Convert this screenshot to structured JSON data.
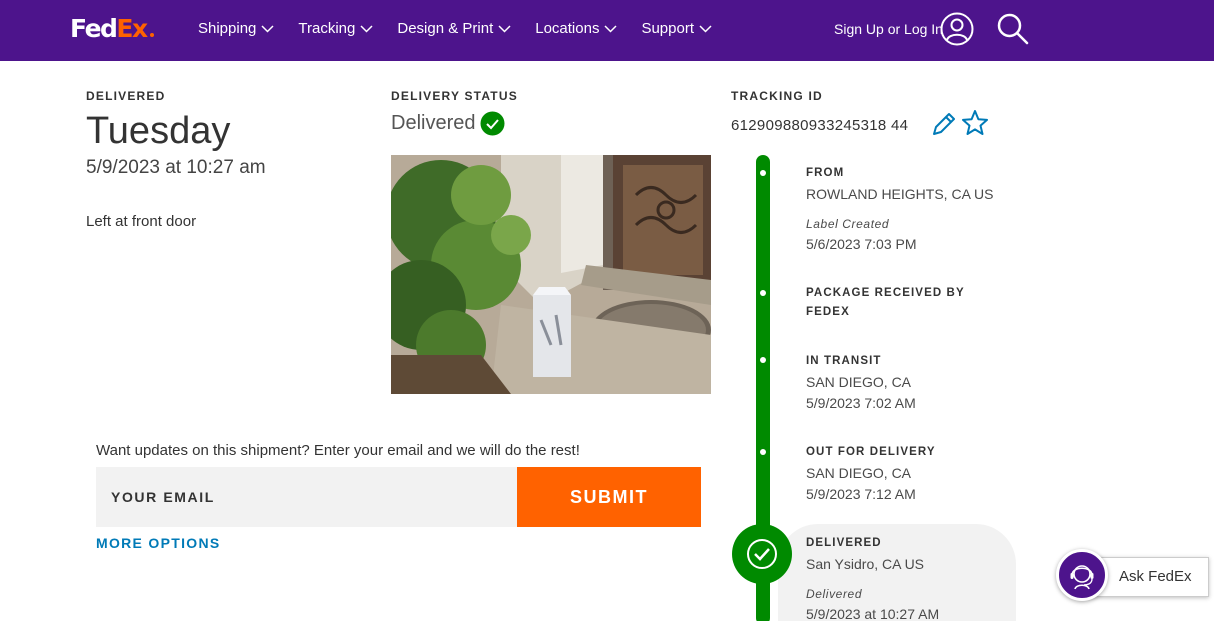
{
  "header": {
    "logo": {
      "fed": "Fed",
      "ex": "Ex"
    },
    "nav": [
      {
        "label": "Shipping"
      },
      {
        "label": "Tracking"
      },
      {
        "label": "Design & Print"
      },
      {
        "label": "Locations"
      },
      {
        "label": "Support"
      }
    ],
    "signin_label": "Sign Up or Log In",
    "user_icon": "user-circle-icon",
    "search_icon": "magnifier-icon"
  },
  "delivered_section": {
    "label": "DELIVERED",
    "day": "Tuesday",
    "datetime": "5/9/2023 at 10:27 am",
    "note": "Left at front door"
  },
  "status_section": {
    "label": "DELIVERY STATUS",
    "value": "Delivered",
    "status_icon": "check-circle-icon"
  },
  "tracking_section": {
    "label": "TRACKING ID",
    "number": "612909880933245318 44",
    "edit_icon": "pencil-icon",
    "favorite_icon": "star-outline-icon"
  },
  "timeline": {
    "events": [
      {
        "title": "FROM",
        "location": "ROWLAND HEIGHTS, CA US",
        "status": "Label Created",
        "datetime": "5/6/2023 7:03 PM"
      },
      {
        "title": "PACKAGE RECEIVED BY FEDEX"
      },
      {
        "title": "IN TRANSIT",
        "location": "SAN DIEGO, CA",
        "datetime": "5/9/2023 7:02 AM"
      },
      {
        "title": "OUT FOR DELIVERY",
        "location": "SAN DIEGO, CA",
        "datetime": "5/9/2023 7:12 AM"
      },
      {
        "title": "DELIVERED",
        "location": "San Ysidro, CA US",
        "status": "Delivered",
        "datetime": "5/9/2023 at 10:27 AM"
      }
    ]
  },
  "email_form": {
    "prompt": "Want updates on this shipment? Enter your email and we will do the rest!",
    "placeholder": "YOUR EMAIL",
    "submit_label": "SUBMIT",
    "more_options_label": "MORE OPTIONS"
  },
  "ask_fedex": {
    "label": "Ask FedEx",
    "icon": "headset-agent-icon"
  },
  "colors": {
    "brand_purple": "#4d148c",
    "brand_orange": "#ff6200",
    "status_green": "#008a00",
    "link_blue": "#007ab7"
  }
}
